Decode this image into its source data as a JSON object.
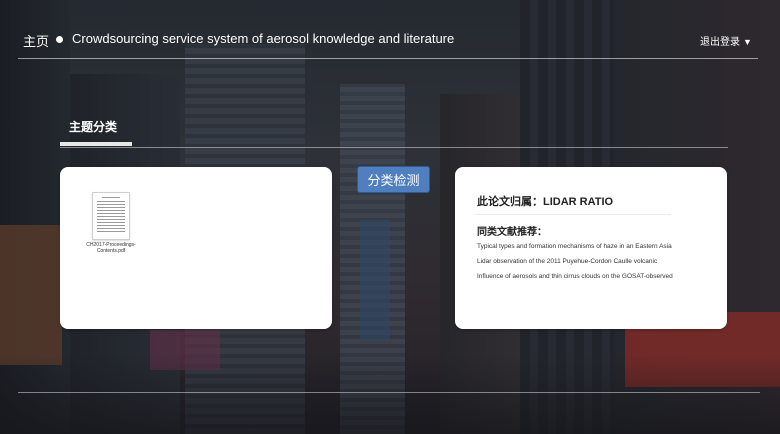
{
  "header": {
    "home_label": "主页",
    "site_title": "Crowdsourcing service system of aerosol knowledge and literature",
    "logout_label": "退出登录",
    "logout_caret": "▼"
  },
  "section": {
    "title": "主题分类"
  },
  "upload_panel": {
    "files": [
      {
        "name": "CH2017-Proceedings-Contents.pdf"
      }
    ]
  },
  "detect_button": {
    "label": "分类检测"
  },
  "result_panel": {
    "belongs_label": "此论文归属：LIDAR RATIO",
    "similar_title": "同类文献推荐：",
    "similar_items": [
      "Typical types and formation mechanisms of haze in an Eastern Asia",
      "Lidar observation of the 2011 Puyehue-Cordon Caulle volcanic",
      "Influence of aerosols and thin cirrus clouds on the GOSAT-observed"
    ]
  }
}
